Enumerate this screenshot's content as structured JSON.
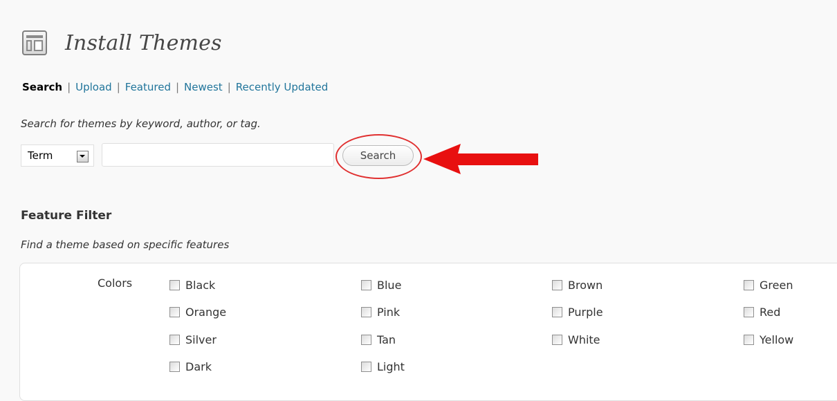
{
  "header": {
    "title": "Install Themes",
    "icon": "themes-icon"
  },
  "subnav": {
    "current": "Search",
    "links": [
      "Upload",
      "Featured",
      "Newest",
      "Recently Updated"
    ],
    "separator": "|"
  },
  "search": {
    "description": "Search for themes by keyword, author, or tag.",
    "type_selected": "Term",
    "input_value": "",
    "button_label": "Search"
  },
  "feature_filter": {
    "title": "Feature Filter",
    "description": "Find a theme based on specific features",
    "colors_label": "Colors",
    "colors": [
      "Black",
      "Blue",
      "Brown",
      "Green",
      "Orange",
      "Pink",
      "Purple",
      "Red",
      "Silver",
      "Tan",
      "White",
      "Yellow",
      "Dark",
      "Light"
    ]
  },
  "annotation": {
    "color": "#e81010"
  },
  "colors": {
    "link": "#21759b",
    "background": "#f9f9f9"
  }
}
